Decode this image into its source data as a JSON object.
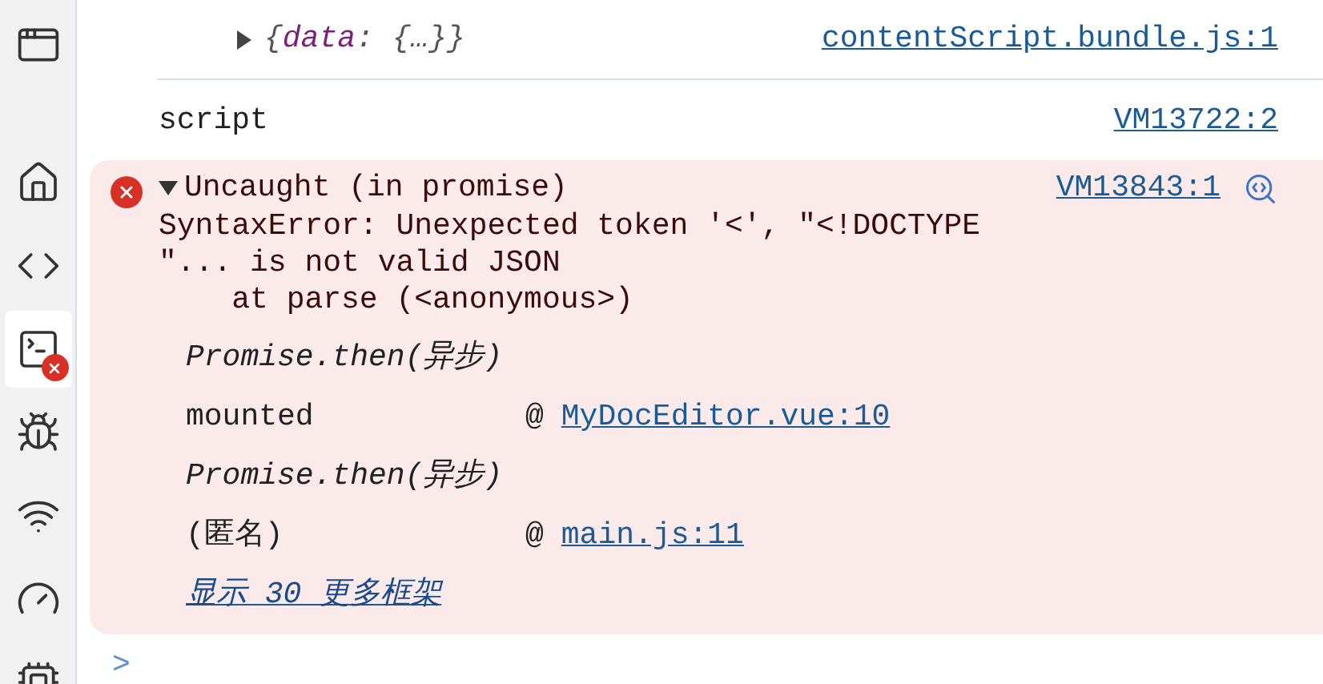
{
  "sidebar": {
    "items": [
      {
        "selected": false,
        "error": false
      },
      {
        "selected": false,
        "error": false
      },
      {
        "selected": false,
        "error": false
      },
      {
        "selected": true,
        "error": true
      },
      {
        "selected": false,
        "error": false
      },
      {
        "selected": false,
        "error": false
      },
      {
        "selected": false,
        "error": false
      },
      {
        "selected": false,
        "error": false
      }
    ]
  },
  "console": {
    "messages": [
      {
        "kind": "object",
        "expanded": false,
        "preview": [
          {
            "kind": "punct",
            "text": "{"
          },
          {
            "kind": "key",
            "text": "data"
          },
          {
            "kind": "punct",
            "text": ": {…}}"
          }
        ],
        "source": "contentScript.bundle.js:1"
      },
      {
        "kind": "log",
        "text": "script",
        "source": "VM13722:2"
      },
      {
        "kind": "error",
        "expanded": true,
        "title": "Uncaught (in promise)",
        "source": "VM13843:1",
        "message": "SyntaxError: Unexpected token '<', \"<!DOCTYPE\n\"... is not valid JSON\n    at parse (<anonymous>)",
        "stack": [
          {
            "kind": "async",
            "text": "Promise.then(异步)"
          },
          {
            "kind": "frame",
            "function": "mounted",
            "at": "@",
            "location": "MyDocEditor.vue:10"
          },
          {
            "kind": "async",
            "text": "Promise.then(异步)"
          },
          {
            "kind": "frame",
            "function": "(匿名)",
            "at": "@",
            "location": "main.js:11"
          }
        ],
        "more_link": "显示 30 更多框架"
      }
    ],
    "prompt": ">"
  }
}
